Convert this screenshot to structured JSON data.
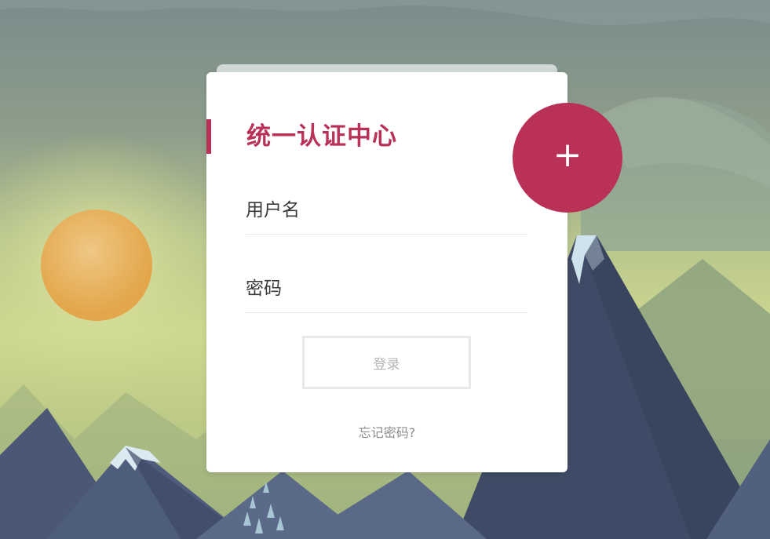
{
  "login": {
    "title": "统一认证中心",
    "username_placeholder": "用户名",
    "username_value": "",
    "password_placeholder": "密码",
    "password_value": "",
    "submit_label": "登录",
    "forgot_link": "忘记密码?",
    "add_button_icon": "plus-icon",
    "add_button_symbol": "+"
  },
  "colors": {
    "accent": "#b93156",
    "sky_top": "#7b8f8c",
    "sky_glow": "#cbd78e",
    "sun": "#e8b867",
    "mountain_dark": "#3d4a66",
    "mountain_mid": "#4d5b7a",
    "snow": "#cfe3ec"
  }
}
